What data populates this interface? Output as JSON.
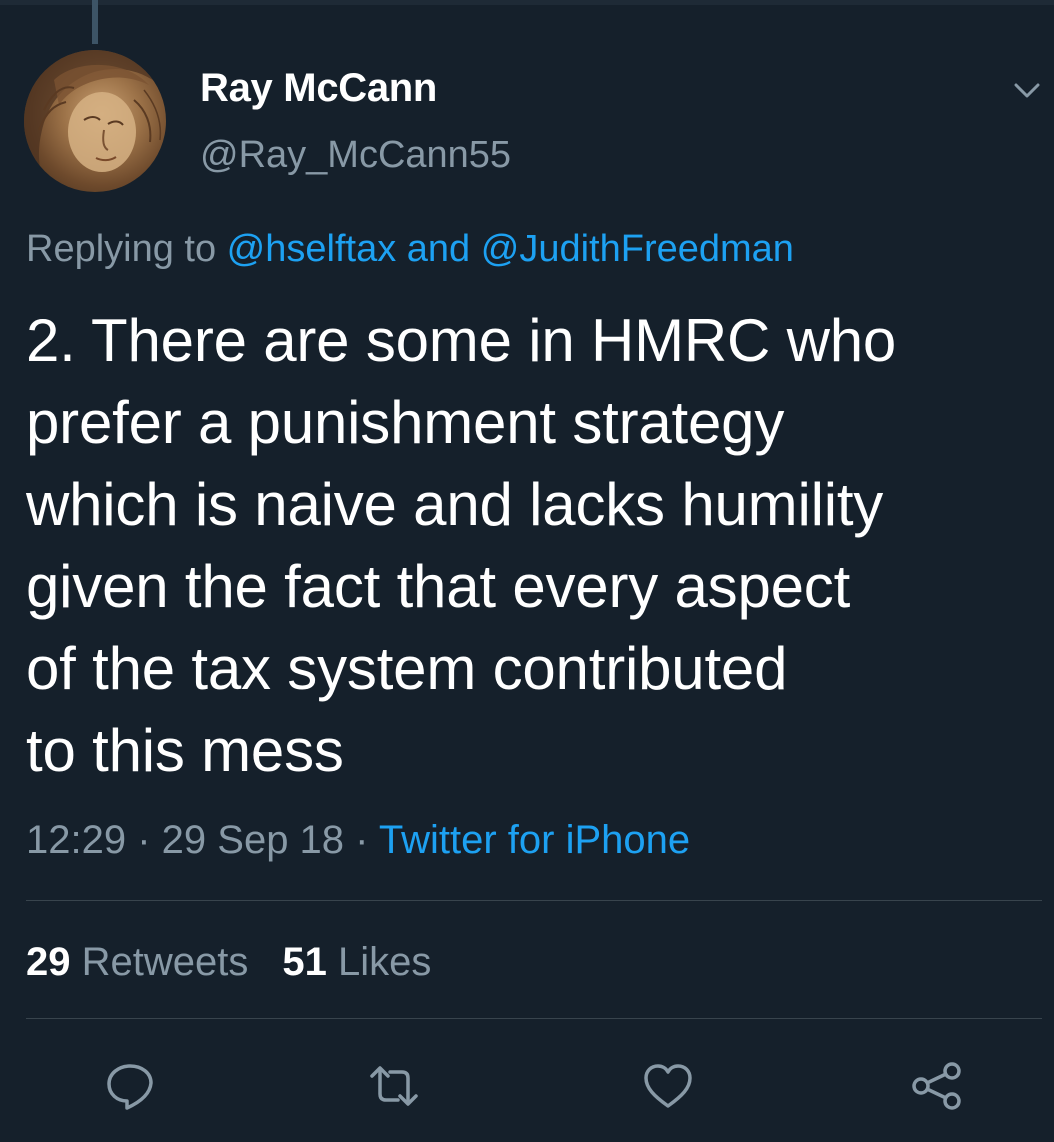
{
  "tweet": {
    "author": {
      "display_name": "Ray McCann",
      "handle": "@Ray_McCann55"
    },
    "reply_context": {
      "prefix": "Replying to ",
      "user1": "@hselftax",
      "conjunction": " and ",
      "user2": "@JudithFreedman"
    },
    "text_lines": [
      "2. There are some in HMRC who",
      "prefer a punishment strategy",
      "which is naive and lacks humility",
      "given the fact that every aspect",
      "of the tax system contributed",
      "to this mess"
    ],
    "time": "12:29",
    "separator": " · ",
    "date": "29 Sep 18",
    "source": "Twitter for iPhone",
    "stats": {
      "retweets_count": "29",
      "retweets_label": " Retweets",
      "likes_count": "51",
      "likes_label": " Likes"
    }
  },
  "icons": {
    "menu": "chevron-down-icon",
    "reply": "reply-icon",
    "retweet": "retweet-icon",
    "like": "heart-icon",
    "share": "share-icon"
  },
  "colors": {
    "background": "#15202b",
    "text_primary": "#ffffff",
    "text_secondary": "#8899a6",
    "accent": "#1da1f2",
    "divider": "#38444d"
  }
}
